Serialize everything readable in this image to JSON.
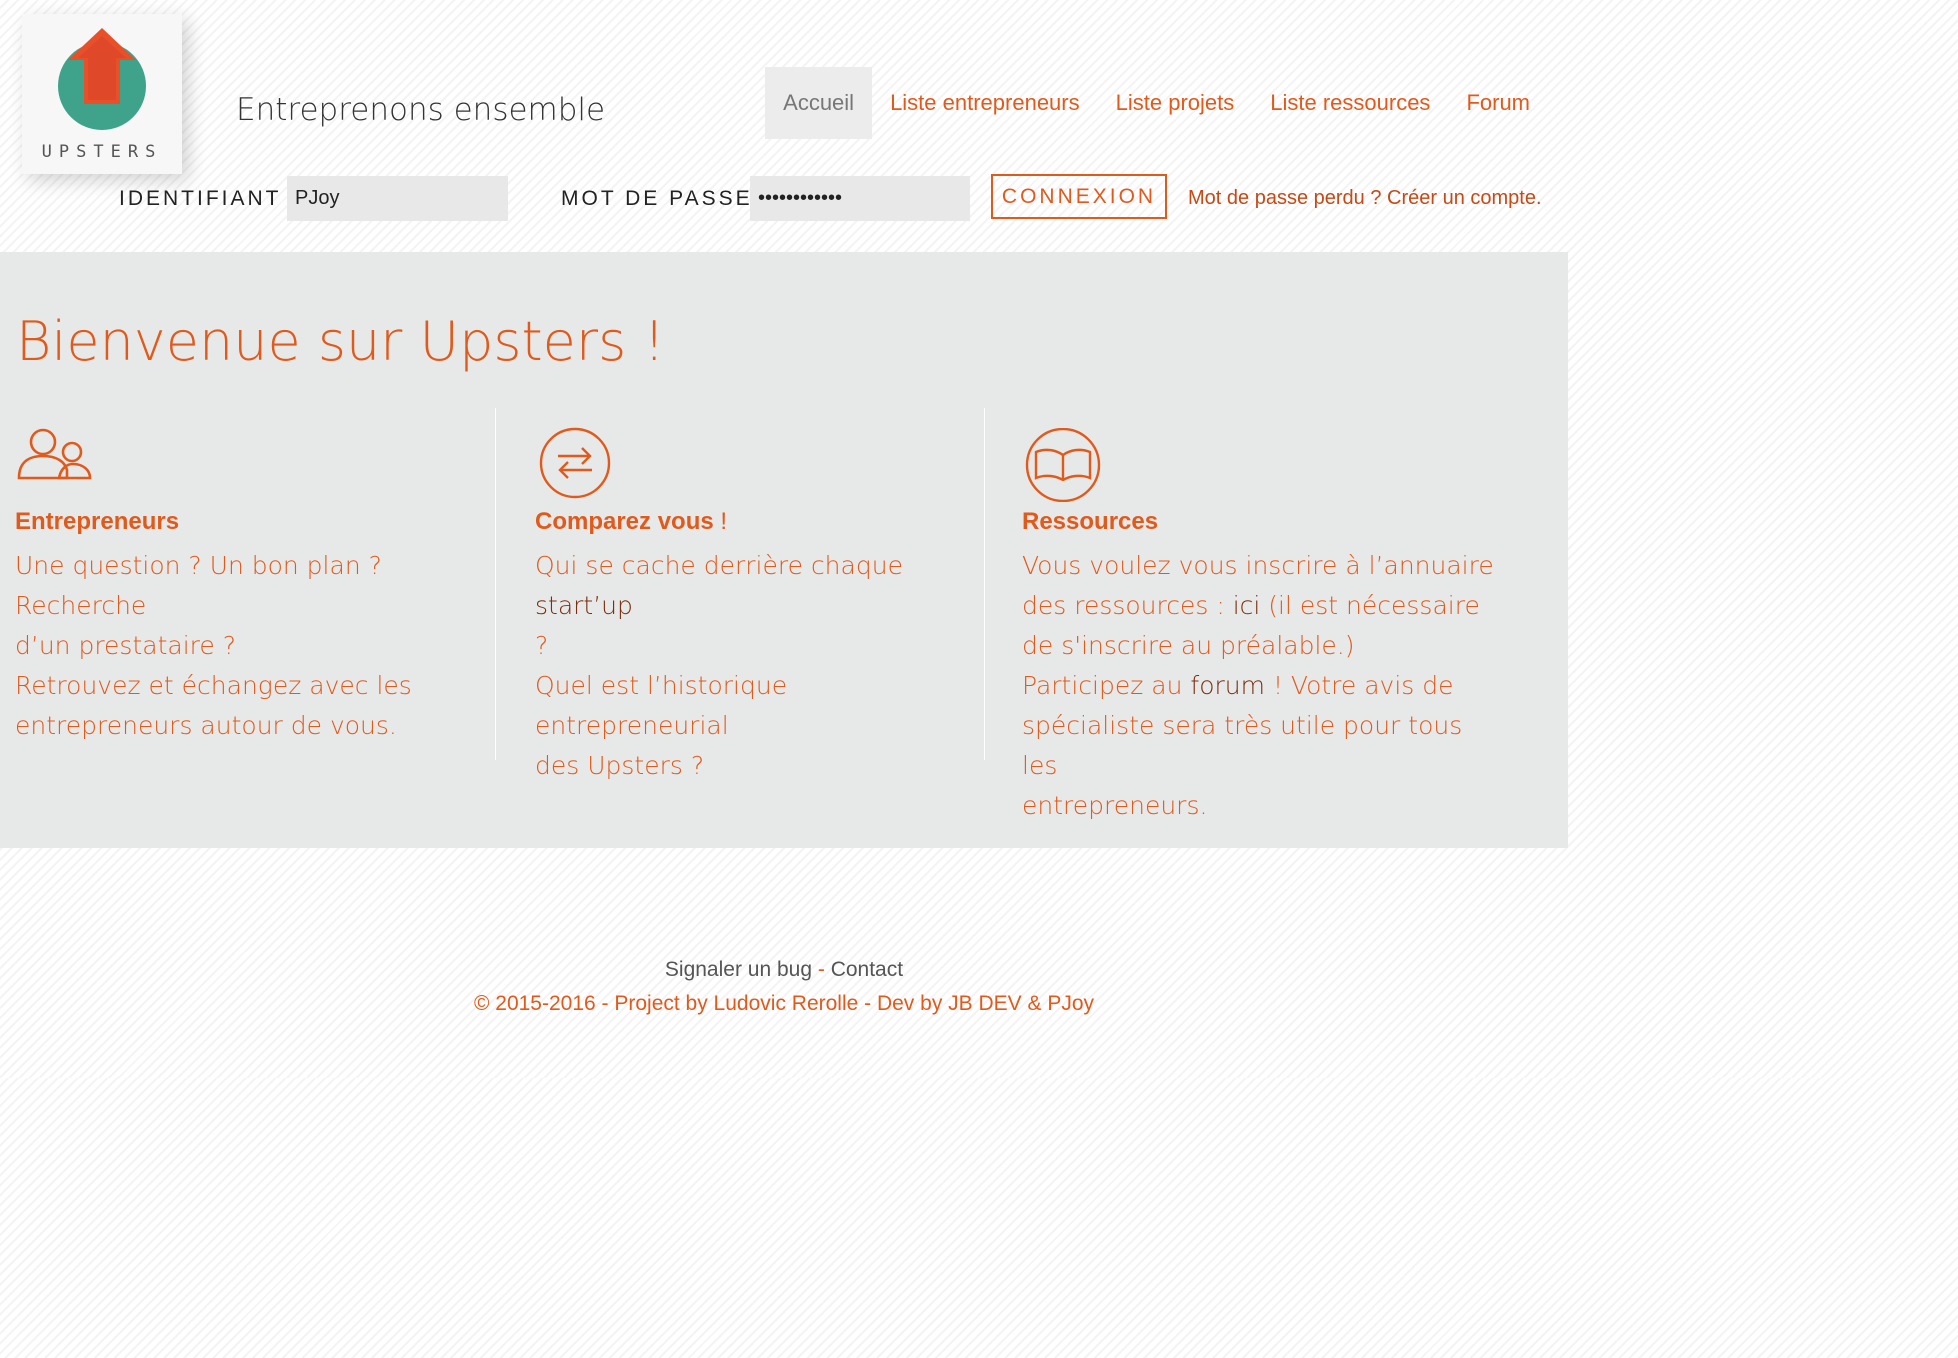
{
  "header": {
    "logo_text": "UPSTERS",
    "tagline": "Entreprenons ensemble"
  },
  "nav": {
    "items": [
      {
        "label": "Accueil"
      },
      {
        "label": "Liste entrepreneurs"
      },
      {
        "label": "Liste projets"
      },
      {
        "label": "Liste ressources"
      },
      {
        "label": "Forum"
      }
    ]
  },
  "login": {
    "identifiant_label": "IDENTIFIANT",
    "identifiant_value": "PJoy",
    "password_label": "MOT DE PASSE",
    "password_value": "••••••••••••",
    "connexion_label": "CONNEXION",
    "lost_password": "Mot de passe perdu ?",
    "create_account": "Créer un compte."
  },
  "main": {
    "welcome": "Bienvenue sur Upsters !",
    "columns": [
      {
        "icon": "users-icon",
        "title": "Entrepreneurs",
        "lines": [
          "Une question ? Un bon plan ? Recherche",
          "d’un prestataire ?",
          "Retrouvez et échangez avec les",
          "entrepreneurs autour de vous."
        ]
      },
      {
        "icon": "exchange-icon",
        "title": "Comparez vous",
        "title_suffix": " !",
        "line1_a": "Qui se cache derrière chaque ",
        "line1_b": "start’up",
        "lines_rest": [
          "?",
          "Quel est l’historique entrepreneurial",
          "des Upsters ?"
        ]
      },
      {
        "icon": "book-icon",
        "title": "Ressources",
        "line1": "Vous voulez vous inscrire à l’annuaire",
        "line2_a": "des ressources : ",
        "line2_b": "ici",
        "line2_c": " (il est nécessaire",
        "line3": "de s'inscrire au préalable.)",
        "line4_a": "Participez au ",
        "line4_b": "forum",
        "line4_c": " ! Votre avis de",
        "line5": "spécialiste sera très utile pour tous les",
        "line6": "entrepreneurs."
      }
    ]
  },
  "footer": {
    "bug_link": "Signaler un bug",
    "separator": " - ",
    "contact_link": "Contact",
    "copyright": "© 2015-2016 - Project by Ludovic Rerolle - Dev by JB DEV & PJoy"
  },
  "colors": {
    "accent": "#e05a1c",
    "logo_green": "#3fa38c",
    "background_main": "#e7e8e8"
  }
}
